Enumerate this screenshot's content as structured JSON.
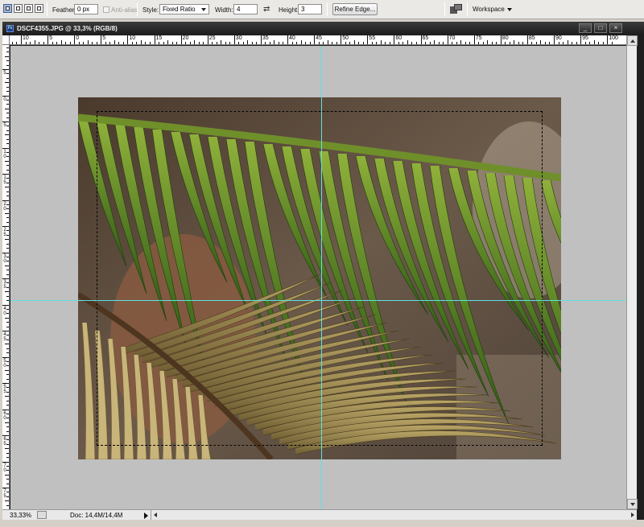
{
  "options_bar": {
    "feather_label": "Feather:",
    "feather_value": "0 px",
    "antialias_label": "Anti-alias",
    "style_label": "Style:",
    "style_value": "Fixed Ratio",
    "width_label": "Width:",
    "width_value": "4",
    "height_label": "Height:",
    "height_value": "3",
    "refine_edge_label": "Refine Edge...",
    "workspace_label": "Workspace"
  },
  "document": {
    "title": "DSCF4355.JPG @ 33,3% (RGB/8)",
    "app_icon_text": "Ps",
    "window_buttons": [
      "_",
      "□",
      "×"
    ]
  },
  "rulers": {
    "horizontal_labels": [
      "10",
      "5",
      "0",
      "5",
      "10",
      "15",
      "20",
      "25",
      "30",
      "35",
      "40",
      "45",
      "50",
      "55",
      "60",
      "65",
      "70",
      "75",
      "80",
      "85",
      "90",
      "95",
      "100"
    ],
    "vertical_labels": [
      "5",
      "0",
      "5",
      "10",
      "15",
      "20",
      "25",
      "30",
      "35",
      "40",
      "45",
      "50",
      "55",
      "60",
      "65",
      "70",
      "75",
      "80"
    ]
  },
  "status_bar": {
    "zoom": "33,33%",
    "doc_size": "Doc: 14,4M/14,4M"
  },
  "colors": {
    "guide": "#5fe0e0",
    "canvas_background": "#c0c0c0"
  }
}
